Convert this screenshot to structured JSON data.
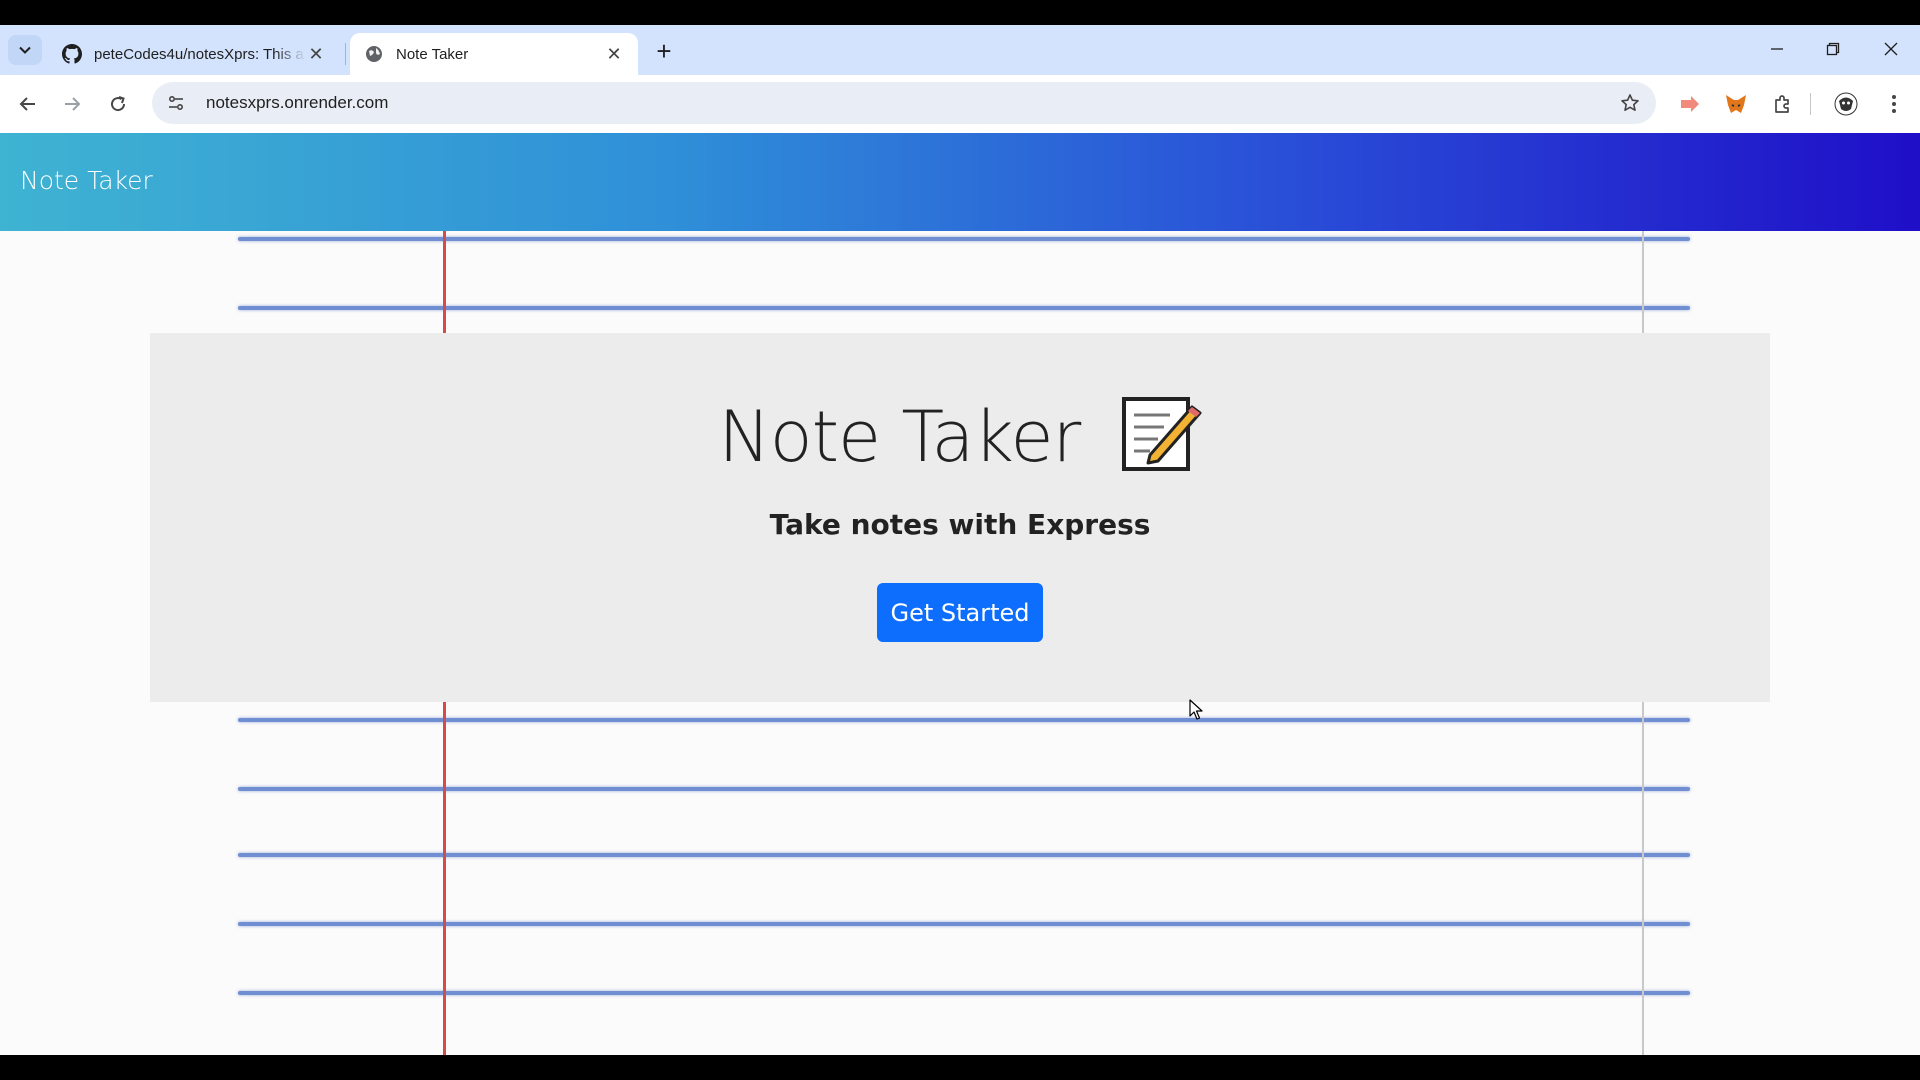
{
  "browser": {
    "tabs": [
      {
        "title": "peteCodes4u/notesXprs: This a",
        "icon": "github-icon",
        "active": false
      },
      {
        "title": "Note Taker",
        "icon": "globe-icon",
        "active": true
      }
    ],
    "address": "notesxprs.onrender.com"
  },
  "page": {
    "navbar_brand": "Note Taker",
    "jumbotron": {
      "title": "Note Taker",
      "title_icon": "notepad-pencil-icon",
      "subtitle": "Take notes with Express",
      "button_label": "Get Started"
    }
  },
  "colors": {
    "button": "#0d6efd",
    "navbar_start": "#3fb3d2",
    "navbar_end": "#1f0fc8",
    "margin_line": "#d64a4a",
    "ruled_line": "#6f8fd2"
  }
}
